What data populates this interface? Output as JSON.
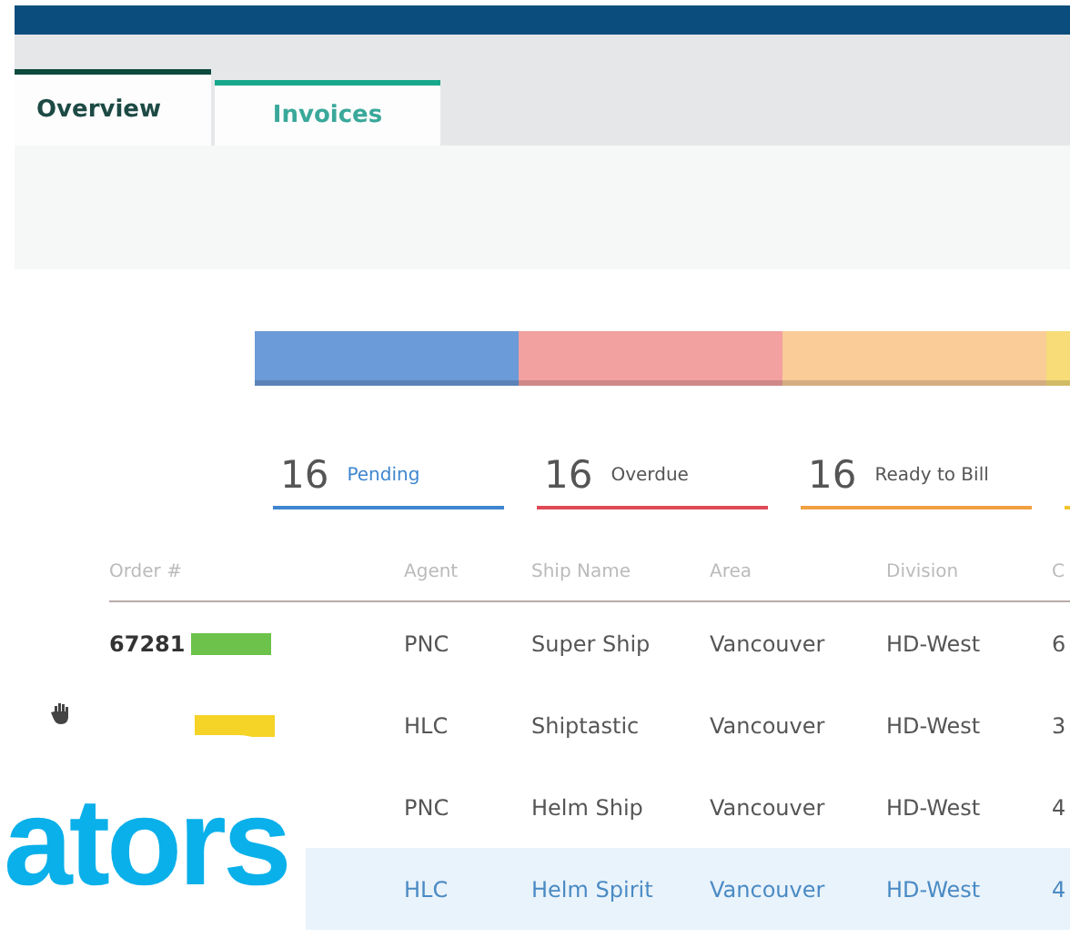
{
  "tabs": [
    {
      "label": "Overview",
      "selected": true
    },
    {
      "label": "Invoices",
      "selected": false
    }
  ],
  "status_bar": [
    {
      "color": "#6b9bd8"
    },
    {
      "color": "#f2a0a0"
    },
    {
      "color": "#f9cc98"
    },
    {
      "color": "#f7dc78"
    }
  ],
  "summary": [
    {
      "count": "16",
      "label": "Pending",
      "color": "#3f86cf"
    },
    {
      "count": "16",
      "label": "Overdue",
      "color": "#e04a57"
    },
    {
      "count": "16",
      "label": "Ready to Bill",
      "color": "#f0a040"
    },
    {
      "color": "#f2c530"
    }
  ],
  "table": {
    "columns": [
      "Order #",
      "Agent",
      "Ship Name",
      "Area",
      "Division",
      "C"
    ],
    "rows": [
      {
        "cells": [
          "67281",
          "PNC",
          "Super Ship",
          "Vancouver",
          "HD-West",
          "6"
        ],
        "badge": {
          "color": "#6cc24a"
        },
        "selected": false
      },
      {
        "cells": [
          "",
          "HLC",
          "Shiptastic",
          "Vancouver",
          "HD-West",
          "3"
        ],
        "badge": {
          "color": "#f5d327"
        },
        "selected": false,
        "flag": true
      },
      {
        "cells": [
          "",
          "PNC",
          "Helm Ship",
          "Vancouver",
          "HD-West",
          "4"
        ],
        "selected": false
      },
      {
        "cells": [
          "",
          "HLC",
          "Helm Spirit",
          "Vancouver",
          "HD-West",
          "4"
        ],
        "selected": true
      }
    ]
  },
  "overlay": {
    "text": "ators"
  }
}
